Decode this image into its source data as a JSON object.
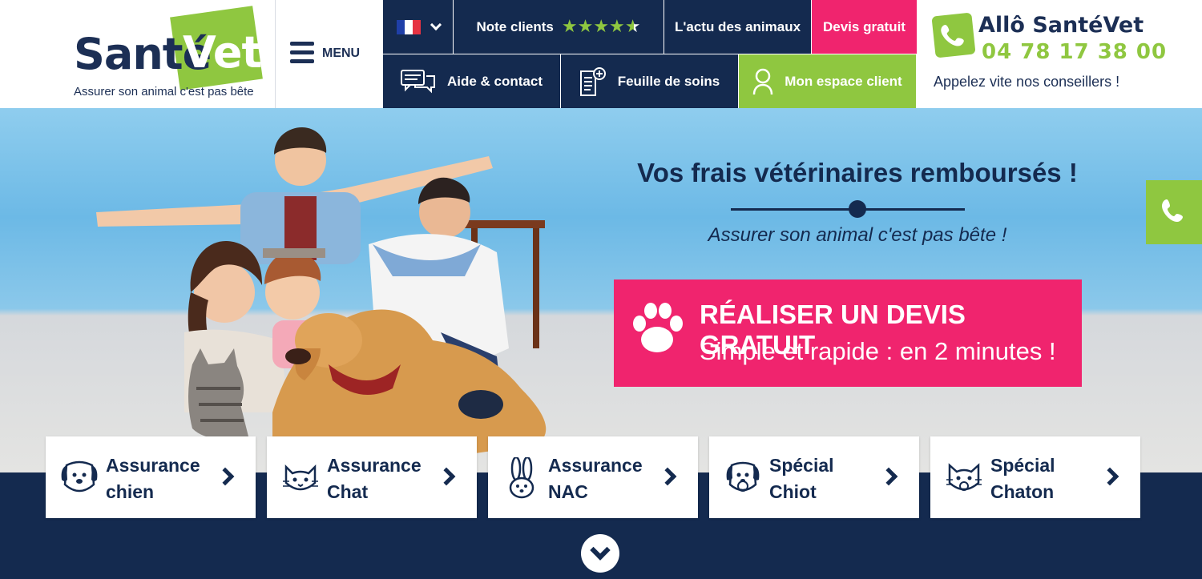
{
  "logo": {
    "brand_part1": "Santé",
    "brand_part2": "Vet",
    "tagline": "Assurer son animal c'est pas bête"
  },
  "menu": {
    "label": "MENU"
  },
  "nav": {
    "language_flag": "fr-flag-icon",
    "reviews_label": "Note clients",
    "reviews_rating": 4.5,
    "reviews_max": 5,
    "news_label": "L'actu des animaux",
    "quote_label": "Devis gratuit",
    "help_label": "Aide & contact",
    "care_sheet_label": "Feuille de soins",
    "client_space_label": "Mon espace client"
  },
  "call": {
    "title": "Allô SantéVet",
    "phone": "04 78 17 38 00",
    "subtitle": "Appelez vite nos conseillers !"
  },
  "hero": {
    "title": "Vos frais vétérinaires remboursés !",
    "subtitle": "Assurer son animal c'est pas bête !",
    "cta_title": "RÉALISER UN DEVIS GRATUIT",
    "cta_subtitle": "Simple et rapide : en 2 minutes !"
  },
  "cards": [
    {
      "line1": "Assurance",
      "line2": "chien",
      "icon": "dog-icon"
    },
    {
      "line1": "Assurance",
      "line2": "Chat",
      "icon": "cat-icon"
    },
    {
      "line1": "Assurance",
      "line2": "NAC",
      "icon": "rabbit-icon"
    },
    {
      "line1": "Spécial",
      "line2": "Chiot",
      "icon": "puppy-icon"
    },
    {
      "line1": "Spécial",
      "line2": "Chaton",
      "icon": "kitten-icon"
    }
  ],
  "colors": {
    "navy": "#142a4f",
    "green": "#8fc740",
    "pink": "#f0246e",
    "sky": "#6cb9e6"
  }
}
